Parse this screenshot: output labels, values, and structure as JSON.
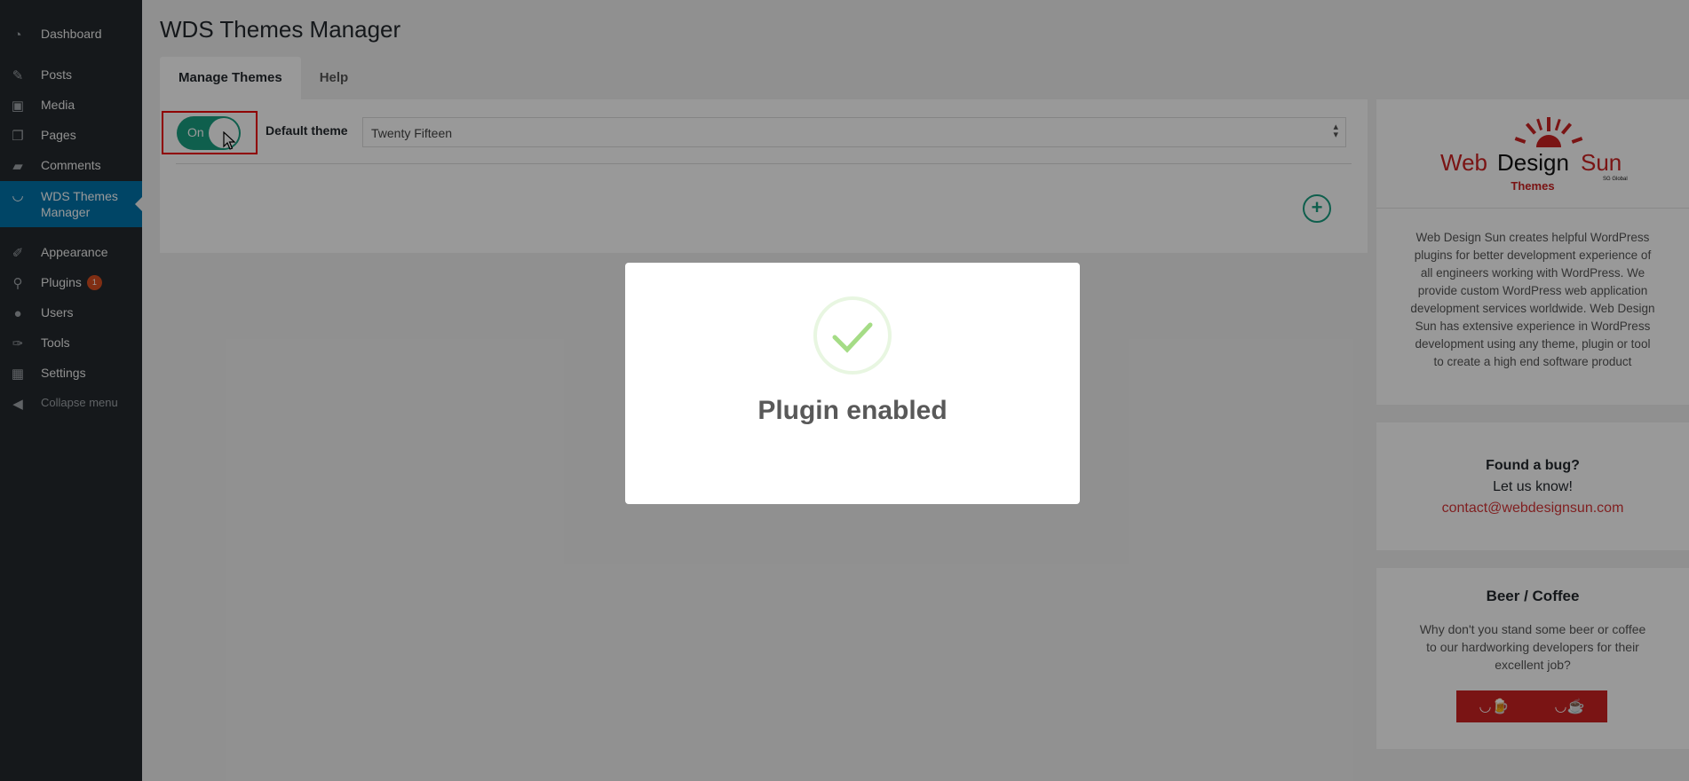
{
  "sidebar": {
    "items": [
      {
        "label": "Dashboard",
        "icon": "dashboard-icon"
      },
      {
        "label": "Posts",
        "icon": "pin-icon"
      },
      {
        "label": "Media",
        "icon": "media-icon"
      },
      {
        "label": "Pages",
        "icon": "pages-icon"
      },
      {
        "label": "Comments",
        "icon": "comment-icon"
      },
      {
        "label": "WDS Themes Manager",
        "icon": "smile-icon",
        "active": true
      },
      {
        "label": "Appearance",
        "icon": "brush-icon"
      },
      {
        "label": "Plugins",
        "icon": "plugin-icon",
        "badge": "1"
      },
      {
        "label": "Users",
        "icon": "user-icon"
      },
      {
        "label": "Tools",
        "icon": "wrench-icon"
      },
      {
        "label": "Settings",
        "icon": "settings-icon"
      },
      {
        "label": "Collapse menu",
        "icon": "collapse-icon"
      }
    ]
  },
  "page": {
    "title": "WDS Themes Manager",
    "tabs": [
      {
        "label": "Manage Themes",
        "active": true
      },
      {
        "label": "Help",
        "active": false
      }
    ]
  },
  "settings": {
    "toggle_label": "On",
    "toggle_state": "on",
    "default_theme_label": "Default theme",
    "default_theme_value": "Twenty Fifteen",
    "add_icon": "plus-circle-icon"
  },
  "widgets": {
    "logo": {
      "word1": "Web",
      "word2": "Design",
      "word3": "Sun",
      "sub": "Themes",
      "tiny": "SG Global"
    },
    "about": "Web Design Sun creates helpful WordPress plugins for better development experience of all engineers working with WordPress. We provide custom WordPress web application development services worldwide. Web Design Sun has extensive experience in WordPress development using any theme, plugin or tool to create a high end software product",
    "bug": {
      "title": "Found a bug?",
      "subtitle": "Let us know!",
      "email": "contact@webdesignsun.com"
    },
    "beer": {
      "title": "Beer / Coffee",
      "text": "Why don't you stand some beer or coffee to our hardworking developers for their excellent job?",
      "buttons": [
        "beer-icon",
        "coffee-icon"
      ]
    }
  },
  "modal": {
    "title": "Plugin enabled",
    "icon": "checkmark-icon"
  },
  "colors": {
    "accent": "#1a9e80",
    "sidebar": "#23282d",
    "active": "#0073aa",
    "brand_red": "#cc2222"
  }
}
